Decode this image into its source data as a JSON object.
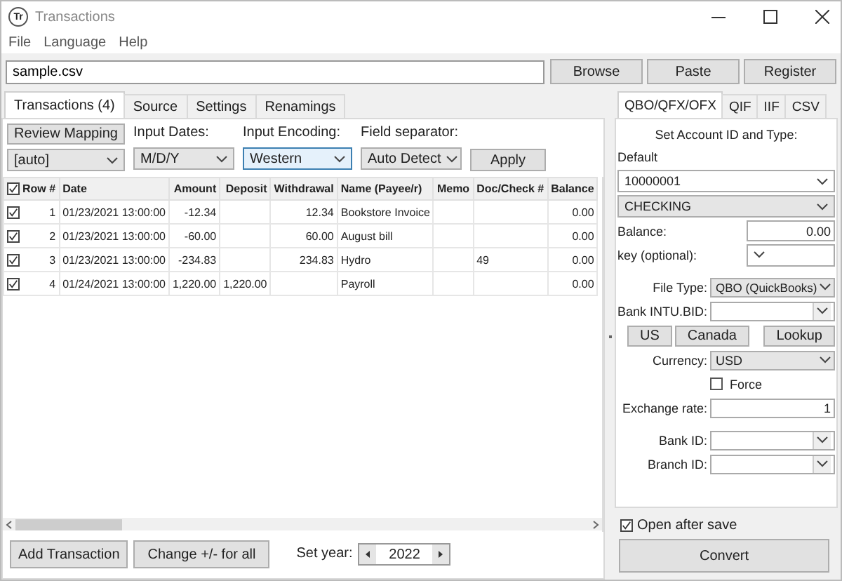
{
  "window": {
    "title": "Transactions",
    "app_icon": "Tr"
  },
  "menu": [
    "File",
    "Language",
    "Help"
  ],
  "file_path": {
    "value": "sample.csv"
  },
  "file_buttons": [
    "Browse",
    "Paste",
    "Register"
  ],
  "main_tabs": [
    {
      "label": "Transactions (4)",
      "selected": true
    },
    {
      "label": "Source",
      "selected": false
    },
    {
      "label": "Settings",
      "selected": false
    },
    {
      "label": "Renamings",
      "selected": false
    }
  ],
  "mapping": {
    "review_button": "Review Mapping",
    "mapping_value": "[auto]",
    "dates_label": "Input Dates:",
    "dates_value": "M/D/Y",
    "encoding_label": "Input Encoding:",
    "encoding_value": "Western",
    "separator_label": "Field separator:",
    "separator_value": "Auto Detect",
    "apply_button": "Apply"
  },
  "table": {
    "all_checked": true,
    "columns": [
      {
        "label": "Row #",
        "kind": "number"
      },
      {
        "label": "Date",
        "kind": "text"
      },
      {
        "label": "Amount",
        "kind": "number"
      },
      {
        "label": "Deposit",
        "kind": "number"
      },
      {
        "label": "Withdrawal",
        "kind": "number"
      },
      {
        "label": "Name (Payee/r)",
        "kind": "text"
      },
      {
        "label": "Memo",
        "kind": "text"
      },
      {
        "label": "Doc/Check #",
        "kind": "text"
      },
      {
        "label": "Balance",
        "kind": "number"
      }
    ],
    "rows": [
      {
        "checked": true,
        "cells": [
          "1",
          "01/23/2021 13:00:00",
          "-12.34",
          "",
          "12.34",
          "Bookstore Invoice",
          "",
          "",
          "0.00"
        ]
      },
      {
        "checked": true,
        "cells": [
          "2",
          "01/23/2021 13:00:00",
          "-60.00",
          "",
          "60.00",
          "August bill",
          "",
          "",
          "0.00"
        ]
      },
      {
        "checked": true,
        "cells": [
          "3",
          "01/23/2021 13:00:00",
          "-234.83",
          "",
          "234.83",
          "Hydro",
          "",
          "49",
          "0.00"
        ]
      },
      {
        "checked": true,
        "cells": [
          "4",
          "01/24/2021 13:00:00",
          "1,220.00",
          "1,220.00",
          "",
          "Payroll",
          "",
          "",
          "0.00"
        ]
      }
    ]
  },
  "bottom": {
    "add_button": "Add Transaction",
    "change_button": "Change +/- for all",
    "year_label": "Set year:",
    "year_value": "2022"
  },
  "export_tabs": [
    {
      "label": "QBO/QFX/OFX",
      "selected": true
    },
    {
      "label": "QIF",
      "selected": false
    },
    {
      "label": "IIF",
      "selected": false
    },
    {
      "label": "CSV",
      "selected": false
    }
  ],
  "account": {
    "heading": "Set Account ID and Type:",
    "default_label": "Default",
    "account_id": "10000001",
    "account_type": "CHECKING",
    "balance_label": "Balance:",
    "balance_value": "0.00",
    "key_label": "key (optional):",
    "file_type_label": "File Type:",
    "file_type_value": "QBO (QuickBooks)",
    "bank_label": "Bank INTU.BID:",
    "us_button": "US",
    "canada_button": "Canada",
    "lookup_button": "Lookup",
    "currency_label": "Currency:",
    "currency_value": "USD",
    "force": {
      "label": "Force",
      "checked": false
    },
    "exchange_label": "Exchange rate:",
    "exchange_value": "1",
    "bank_id_label": "Bank ID:",
    "branch_id_label": "Branch ID:"
  },
  "open_after_save": {
    "label": "Open after save",
    "checked": true
  },
  "convert_button": "Convert"
}
